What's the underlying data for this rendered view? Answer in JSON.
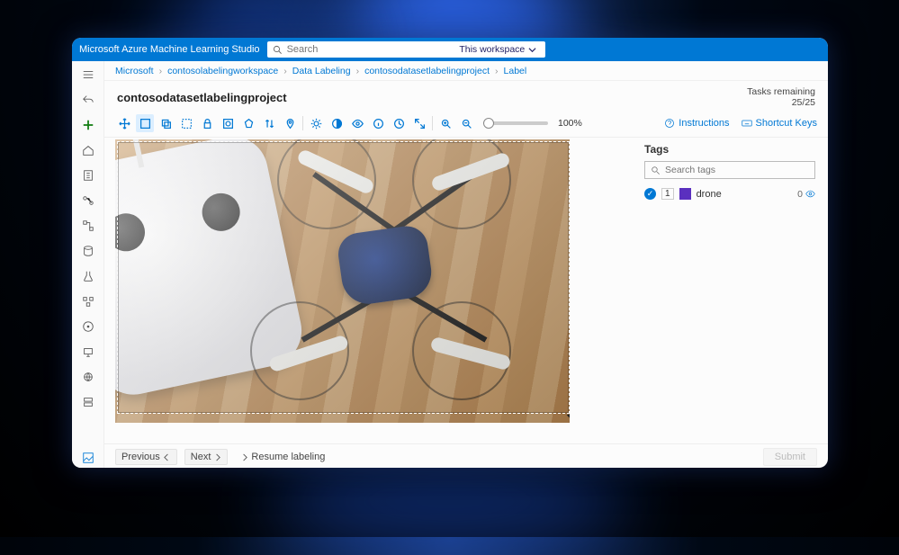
{
  "app": {
    "title": "Microsoft Azure Machine Learning Studio"
  },
  "search": {
    "placeholder": "Search",
    "scope": "This workspace"
  },
  "breadcrumbs": [
    "Microsoft",
    "contosolabelingworkspace",
    "Data Labeling",
    "contosodatasetlabelingproject",
    "Label"
  ],
  "project": {
    "name": "contosodatasetlabelingproject"
  },
  "tasks": {
    "label": "Tasks remaining",
    "count": "25/25"
  },
  "toolbar": {
    "zoom_pct": "100%",
    "instructions": "Instructions",
    "shortcuts": "Shortcut Keys"
  },
  "tags": {
    "heading": "Tags",
    "search_placeholder": "Search tags",
    "items": [
      {
        "num": "1",
        "name": "drone",
        "color": "#5a2fbf",
        "count": "0"
      }
    ]
  },
  "footer": {
    "previous": "Previous",
    "next": "Next",
    "resume": "Resume labeling",
    "submit": "Submit"
  }
}
